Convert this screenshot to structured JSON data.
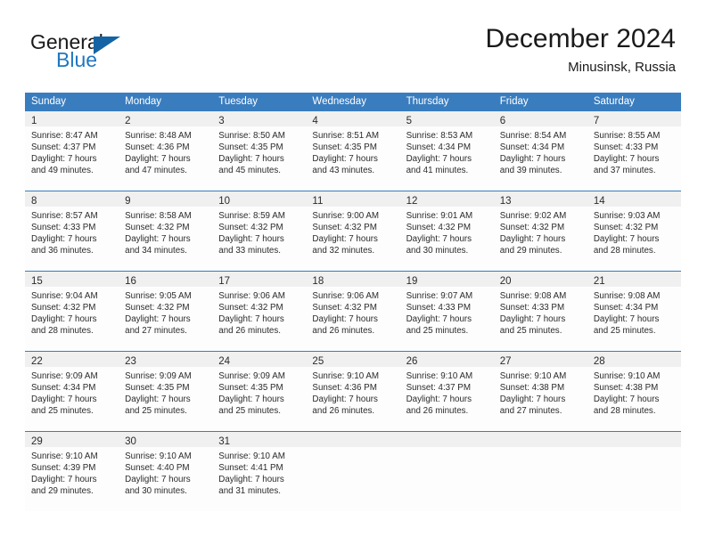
{
  "brand": {
    "name_top": "General",
    "name_bottom": "Blue",
    "logo_icon": "triangle-logo-icon",
    "color_blue": "#2077c0",
    "color_triangle": "#1464a5"
  },
  "header": {
    "title": "December 2024",
    "location": "Minusinsk, Russia"
  },
  "theme": {
    "header_bg": "#3a7dbf",
    "daynum_band_bg": "#f0f0f0",
    "grid_line": "#3a7dbf"
  },
  "calendar": {
    "weekday_headers": [
      "Sunday",
      "Monday",
      "Tuesday",
      "Wednesday",
      "Thursday",
      "Friday",
      "Saturday"
    ],
    "weeks": [
      [
        {
          "day": "1",
          "lines": [
            "Sunrise: 8:47 AM",
            "Sunset: 4:37 PM",
            "Daylight: 7 hours",
            "and 49 minutes."
          ]
        },
        {
          "day": "2",
          "lines": [
            "Sunrise: 8:48 AM",
            "Sunset: 4:36 PM",
            "Daylight: 7 hours",
            "and 47 minutes."
          ]
        },
        {
          "day": "3",
          "lines": [
            "Sunrise: 8:50 AM",
            "Sunset: 4:35 PM",
            "Daylight: 7 hours",
            "and 45 minutes."
          ]
        },
        {
          "day": "4",
          "lines": [
            "Sunrise: 8:51 AM",
            "Sunset: 4:35 PM",
            "Daylight: 7 hours",
            "and 43 minutes."
          ]
        },
        {
          "day": "5",
          "lines": [
            "Sunrise: 8:53 AM",
            "Sunset: 4:34 PM",
            "Daylight: 7 hours",
            "and 41 minutes."
          ]
        },
        {
          "day": "6",
          "lines": [
            "Sunrise: 8:54 AM",
            "Sunset: 4:34 PM",
            "Daylight: 7 hours",
            "and 39 minutes."
          ]
        },
        {
          "day": "7",
          "lines": [
            "Sunrise: 8:55 AM",
            "Sunset: 4:33 PM",
            "Daylight: 7 hours",
            "and 37 minutes."
          ]
        }
      ],
      [
        {
          "day": "8",
          "lines": [
            "Sunrise: 8:57 AM",
            "Sunset: 4:33 PM",
            "Daylight: 7 hours",
            "and 36 minutes."
          ]
        },
        {
          "day": "9",
          "lines": [
            "Sunrise: 8:58 AM",
            "Sunset: 4:32 PM",
            "Daylight: 7 hours",
            "and 34 minutes."
          ]
        },
        {
          "day": "10",
          "lines": [
            "Sunrise: 8:59 AM",
            "Sunset: 4:32 PM",
            "Daylight: 7 hours",
            "and 33 minutes."
          ]
        },
        {
          "day": "11",
          "lines": [
            "Sunrise: 9:00 AM",
            "Sunset: 4:32 PM",
            "Daylight: 7 hours",
            "and 32 minutes."
          ]
        },
        {
          "day": "12",
          "lines": [
            "Sunrise: 9:01 AM",
            "Sunset: 4:32 PM",
            "Daylight: 7 hours",
            "and 30 minutes."
          ]
        },
        {
          "day": "13",
          "lines": [
            "Sunrise: 9:02 AM",
            "Sunset: 4:32 PM",
            "Daylight: 7 hours",
            "and 29 minutes."
          ]
        },
        {
          "day": "14",
          "lines": [
            "Sunrise: 9:03 AM",
            "Sunset: 4:32 PM",
            "Daylight: 7 hours",
            "and 28 minutes."
          ]
        }
      ],
      [
        {
          "day": "15",
          "lines": [
            "Sunrise: 9:04 AM",
            "Sunset: 4:32 PM",
            "Daylight: 7 hours",
            "and 28 minutes."
          ]
        },
        {
          "day": "16",
          "lines": [
            "Sunrise: 9:05 AM",
            "Sunset: 4:32 PM",
            "Daylight: 7 hours",
            "and 27 minutes."
          ]
        },
        {
          "day": "17",
          "lines": [
            "Sunrise: 9:06 AM",
            "Sunset: 4:32 PM",
            "Daylight: 7 hours",
            "and 26 minutes."
          ]
        },
        {
          "day": "18",
          "lines": [
            "Sunrise: 9:06 AM",
            "Sunset: 4:32 PM",
            "Daylight: 7 hours",
            "and 26 minutes."
          ]
        },
        {
          "day": "19",
          "lines": [
            "Sunrise: 9:07 AM",
            "Sunset: 4:33 PM",
            "Daylight: 7 hours",
            "and 25 minutes."
          ]
        },
        {
          "day": "20",
          "lines": [
            "Sunrise: 9:08 AM",
            "Sunset: 4:33 PM",
            "Daylight: 7 hours",
            "and 25 minutes."
          ]
        },
        {
          "day": "21",
          "lines": [
            "Sunrise: 9:08 AM",
            "Sunset: 4:34 PM",
            "Daylight: 7 hours",
            "and 25 minutes."
          ]
        }
      ],
      [
        {
          "day": "22",
          "lines": [
            "Sunrise: 9:09 AM",
            "Sunset: 4:34 PM",
            "Daylight: 7 hours",
            "and 25 minutes."
          ]
        },
        {
          "day": "23",
          "lines": [
            "Sunrise: 9:09 AM",
            "Sunset: 4:35 PM",
            "Daylight: 7 hours",
            "and 25 minutes."
          ]
        },
        {
          "day": "24",
          "lines": [
            "Sunrise: 9:09 AM",
            "Sunset: 4:35 PM",
            "Daylight: 7 hours",
            "and 25 minutes."
          ]
        },
        {
          "day": "25",
          "lines": [
            "Sunrise: 9:10 AM",
            "Sunset: 4:36 PM",
            "Daylight: 7 hours",
            "and 26 minutes."
          ]
        },
        {
          "day": "26",
          "lines": [
            "Sunrise: 9:10 AM",
            "Sunset: 4:37 PM",
            "Daylight: 7 hours",
            "and 26 minutes."
          ]
        },
        {
          "day": "27",
          "lines": [
            "Sunrise: 9:10 AM",
            "Sunset: 4:38 PM",
            "Daylight: 7 hours",
            "and 27 minutes."
          ]
        },
        {
          "day": "28",
          "lines": [
            "Sunrise: 9:10 AM",
            "Sunset: 4:38 PM",
            "Daylight: 7 hours",
            "and 28 minutes."
          ]
        }
      ],
      [
        {
          "day": "29",
          "lines": [
            "Sunrise: 9:10 AM",
            "Sunset: 4:39 PM",
            "Daylight: 7 hours",
            "and 29 minutes."
          ]
        },
        {
          "day": "30",
          "lines": [
            "Sunrise: 9:10 AM",
            "Sunset: 4:40 PM",
            "Daylight: 7 hours",
            "and 30 minutes."
          ]
        },
        {
          "day": "31",
          "lines": [
            "Sunrise: 9:10 AM",
            "Sunset: 4:41 PM",
            "Daylight: 7 hours",
            "and 31 minutes."
          ]
        },
        {
          "day": "",
          "lines": []
        },
        {
          "day": "",
          "lines": []
        },
        {
          "day": "",
          "lines": []
        },
        {
          "day": "",
          "lines": []
        }
      ]
    ]
  }
}
